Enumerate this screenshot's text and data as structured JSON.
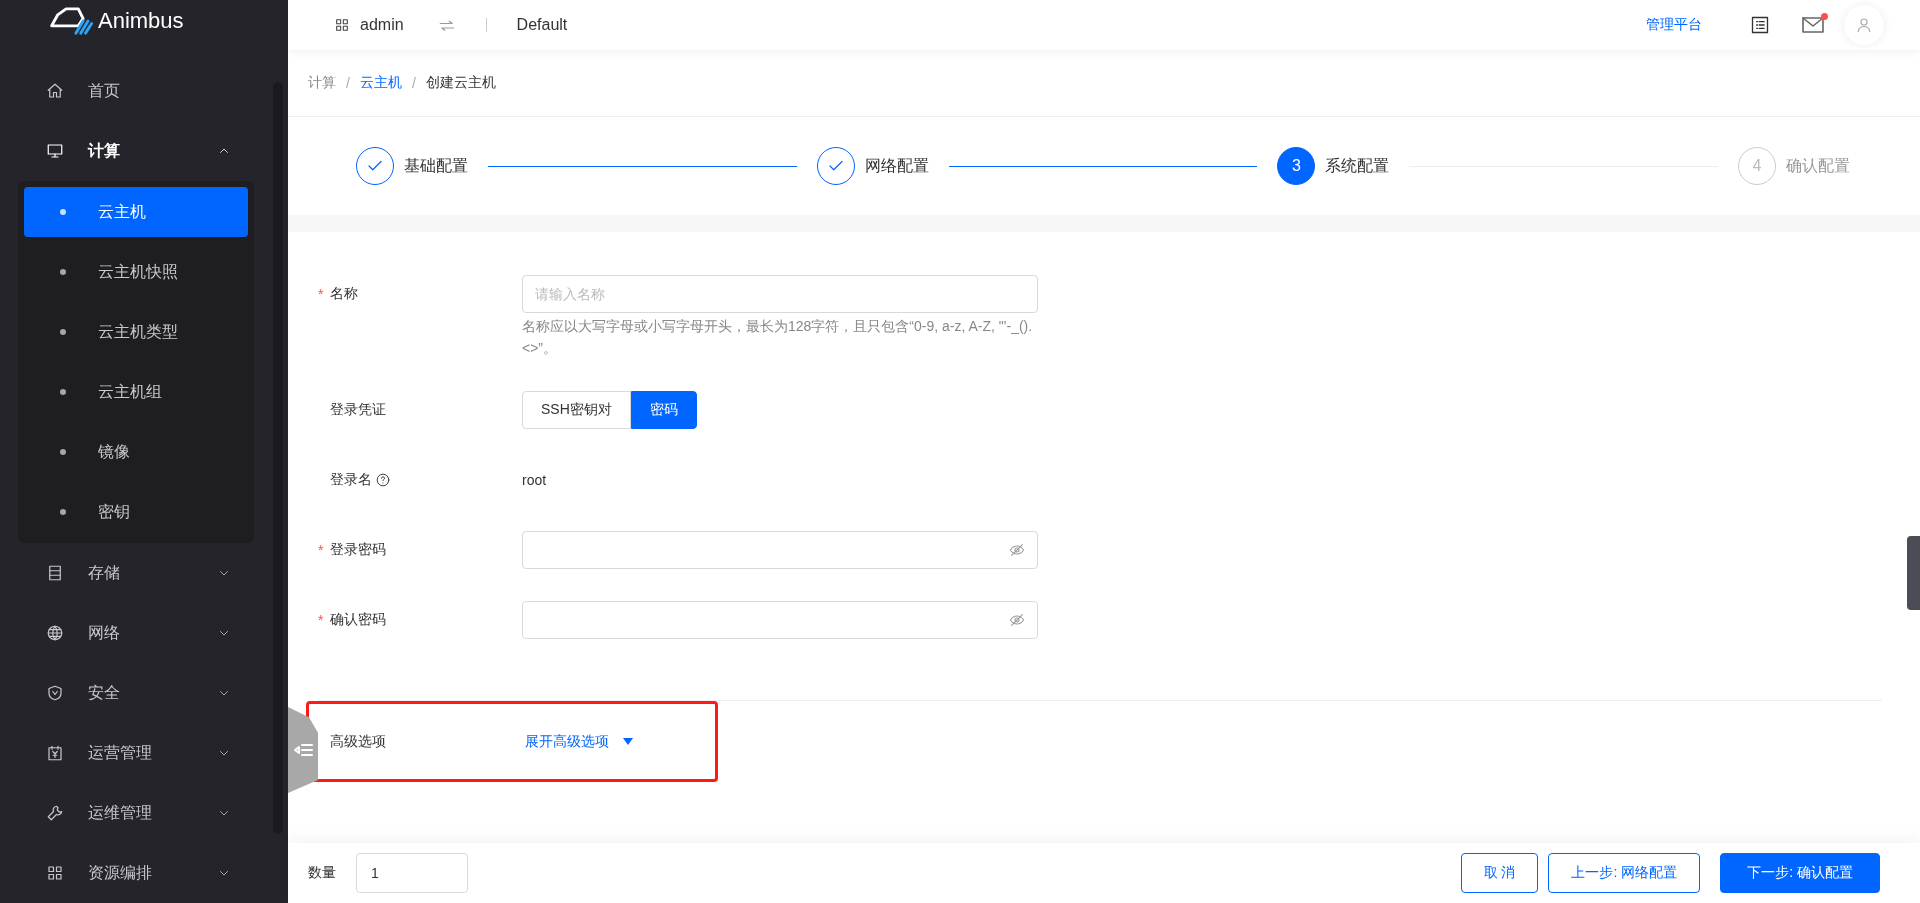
{
  "sidebar": {
    "logo": "Animbus",
    "items": [
      {
        "label": "首页",
        "expanded": false
      },
      {
        "label": "计算",
        "expanded": true,
        "children": [
          {
            "label": "云主机",
            "selected": true
          },
          {
            "label": "云主机快照",
            "selected": false
          },
          {
            "label": "云主机类型",
            "selected": false
          },
          {
            "label": "云主机组",
            "selected": false
          },
          {
            "label": "镜像",
            "selected": false
          },
          {
            "label": "密钥",
            "selected": false
          }
        ]
      },
      {
        "label": "存储",
        "expanded": false
      },
      {
        "label": "网络",
        "expanded": false
      },
      {
        "label": "安全",
        "expanded": false
      },
      {
        "label": "运营管理",
        "expanded": false
      },
      {
        "label": "运维管理",
        "expanded": false
      },
      {
        "label": "资源编排",
        "expanded": false
      }
    ]
  },
  "header": {
    "user": "admin",
    "project": "Default",
    "link": "管理平台",
    "mail_unread": true
  },
  "breadcrumb": {
    "separator": "/",
    "items": [
      {
        "label": "计算",
        "link": false
      },
      {
        "label": "云主机",
        "link": true
      },
      {
        "label": "创建云主机",
        "link": false
      }
    ]
  },
  "steps": [
    {
      "label": "基础配置",
      "done": true,
      "selected": false
    },
    {
      "label": "网络配置",
      "done": true,
      "selected": false
    },
    {
      "number": "3",
      "label": "系统配置",
      "done": false,
      "selected": true
    },
    {
      "number": "4",
      "label": "确认配置",
      "done": false,
      "selected": false
    }
  ],
  "form": {
    "required_mark": "*",
    "fields": [
      {
        "kind": "text",
        "label": "名称",
        "required": true,
        "placeholder": "请输入名称",
        "help": "名称应以大写字母或小写字母开头，最长为128字符，且只包含“0-9, a-z, A-Z, \"'-_().<>”。"
      },
      {
        "kind": "segmented",
        "label": "登录凭证",
        "required": false,
        "options": [
          {
            "label": "SSH密钥对",
            "selected": false
          },
          {
            "label": "密码",
            "selected": true
          }
        ]
      },
      {
        "kind": "static",
        "label": "登录名",
        "required": false,
        "hint": true,
        "value": "root"
      },
      {
        "kind": "password",
        "label": "登录密码",
        "required": true
      },
      {
        "kind": "password",
        "label": "确认密码",
        "required": true
      }
    ]
  },
  "advanced": {
    "label": "高级选项",
    "link": "展开高级选项",
    "highlighted": true
  },
  "footer": {
    "quantity_label": "数量",
    "quantity": "1",
    "buttons": [
      {
        "label": "取 消",
        "kind": "default"
      },
      {
        "label": "上一步: 网络配置",
        "kind": "default"
      },
      {
        "label": "下一步: 确认配置",
        "kind": "primary"
      }
    ]
  }
}
